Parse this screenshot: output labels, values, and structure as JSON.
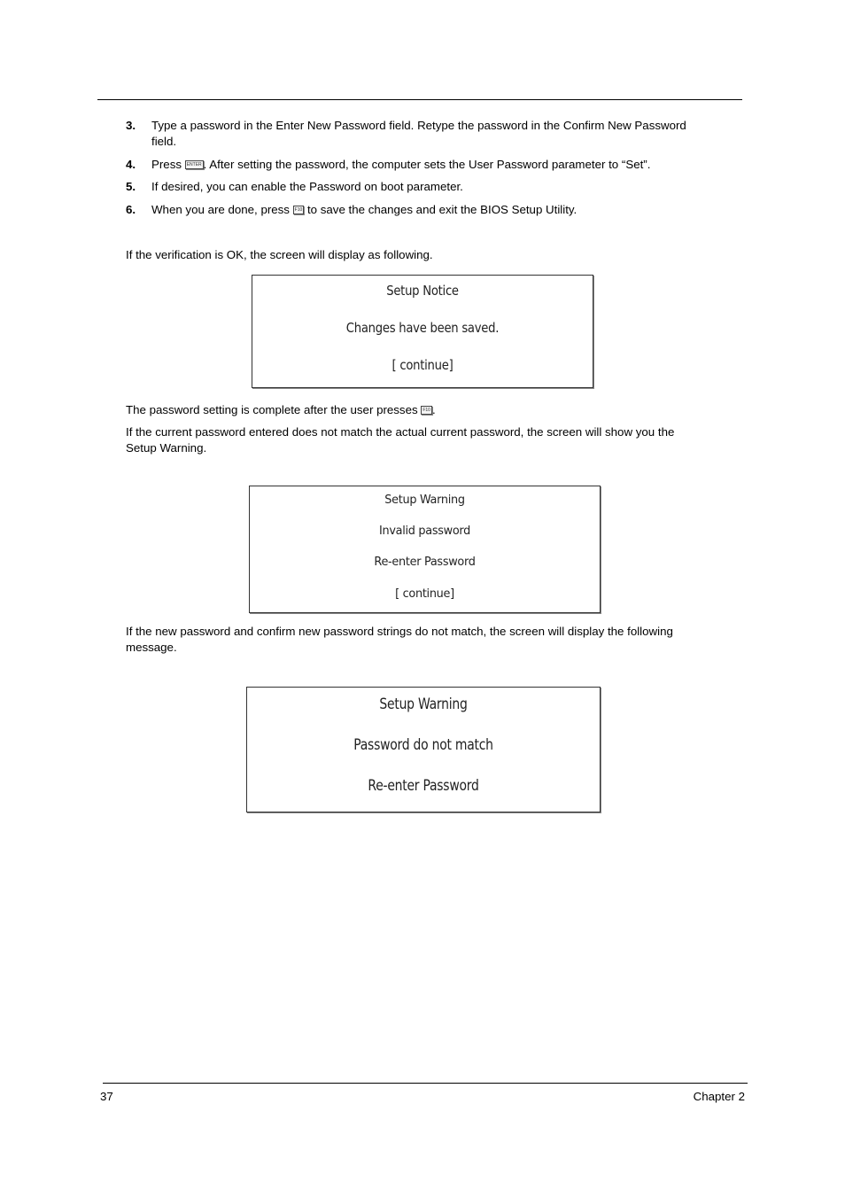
{
  "steps": [
    {
      "number": "3.",
      "text": "Type a password in the Enter New Password field. Retype the password in the Confirm New Password",
      "text_line2": "field."
    },
    {
      "number": "4.",
      "text_before": "Press ",
      "key": "ENTER",
      "text_after": ". After setting the password, the computer sets the User Password parameter to “Set”."
    },
    {
      "number": "5.",
      "text": "If desired, you can enable the Password on boot parameter."
    },
    {
      "number": "6.",
      "text_before": "When you are done, press ",
      "key": "F10",
      "text_after": " to save the changes and exit the BIOS Setup Utility."
    }
  ],
  "paragraphs": {
    "verification_ok": "If the verification is OK, the screen will display as following.",
    "complete_before": "The password setting is complete after the user presses ",
    "complete_key": "F10",
    "complete_after": ".",
    "mismatch_current_line1": "If the current password entered does not match the actual current password, the screen will show you the",
    "mismatch_current_line2": "Setup Warning.",
    "mismatch_new_line1": "If the new password and confirm new password strings do not match, the screen will display the following",
    "mismatch_new_line2": "message."
  },
  "dialogs": {
    "notice": {
      "title": "Setup Notice",
      "message": "Changes have been saved.",
      "action": "[ continue]"
    },
    "invalid": {
      "title": "Setup Warning",
      "message": "Invalid password",
      "message2": "Re-enter Password",
      "action": "[ continue]"
    },
    "nomatch": {
      "title": "Setup Warning",
      "message": "Password do not match",
      "message2": "Re-enter Password"
    }
  },
  "footer": {
    "page_number": "37",
    "chapter": "Chapter 2"
  }
}
